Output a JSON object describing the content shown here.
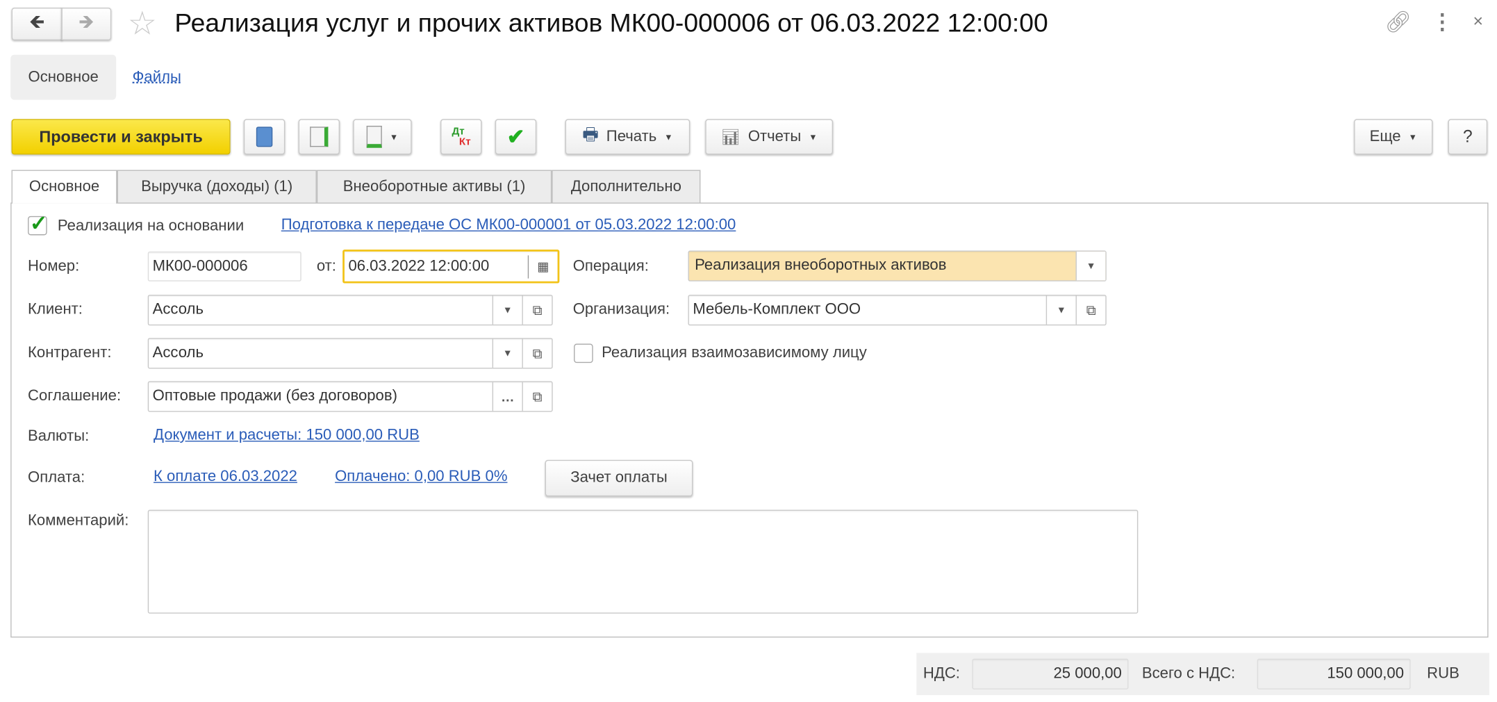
{
  "window": {
    "title": "Реализация услуг и прочих активов МК00-000006 от 06.03.2022 12:00:00"
  },
  "nav_tabs": [
    {
      "label": "Основное"
    },
    {
      "label": "Файлы"
    }
  ],
  "toolbar": {
    "post_close": "Провести и закрыть",
    "print": "Печать",
    "reports": "Отчеты",
    "more": "Еще",
    "help": "?",
    "dt": "Дт",
    "kt": "Кт"
  },
  "tabs": [
    {
      "label": "Основное"
    },
    {
      "label": "Выручка (доходы) (1)"
    },
    {
      "label": "Внеоборотные активы (1)"
    },
    {
      "label": "Дополнительно"
    }
  ],
  "form": {
    "basis_label": "Реализация на основании",
    "basis_checked": true,
    "basis_link": "Подготовка к передаче ОС МК00-000001 от 05.03.2022 12:00:00",
    "number_label": "Номер:",
    "number": "МК00-000006",
    "date_label": "от:",
    "date": "06.03.2022 12:00:00",
    "operation_label": "Операция:",
    "operation": "Реализация внеоборотных активов",
    "client_label": "Клиент:",
    "client": "Ассоль",
    "org_label": "Организация:",
    "org": "Мебель-Комплект ООО",
    "counterparty_label": "Контрагент:",
    "counterparty": "Ассоль",
    "related_label": "Реализация взаимозависимому лицу",
    "related_checked": false,
    "agreement_label": "Соглашение:",
    "agreement": "Оптовые продажи (без договоров)",
    "currency_label": "Валюты:",
    "currency_link": "Документ и расчеты: 150 000,00 RUB",
    "payment_label": "Оплата:",
    "payment_due_link": "К оплате 06.03.2022",
    "paid_link": "Оплачено: 0,00 RUB 0%",
    "offset_button": "Зачет оплаты",
    "comment_label": "Комментарий:",
    "comment": ""
  },
  "footer": {
    "vat_label": "НДС:",
    "vat": "25 000,00",
    "total_label": "Всего с НДС:",
    "total": "150 000,00",
    "currency": "RUB"
  },
  "colors": {
    "primary": "#f5d60f",
    "link": "#2a5cb8",
    "focus": "#f2c318",
    "operation_bg": "#fbe4b0"
  }
}
